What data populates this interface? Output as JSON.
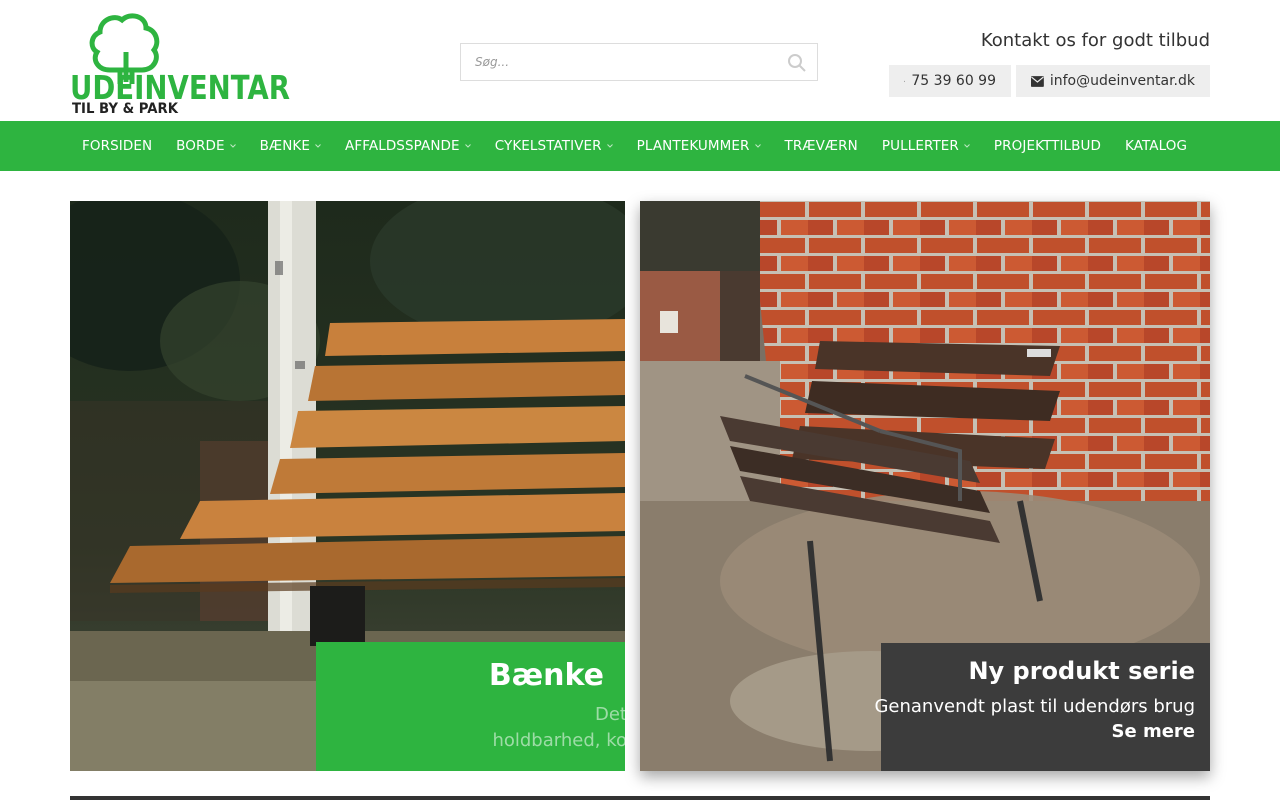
{
  "brand": {
    "logo_main": "UDEINVENTAR",
    "logo_tagline": "TIL BY & PARK",
    "color": "#2eb440"
  },
  "search": {
    "placeholder": "Søg..."
  },
  "contact": {
    "heading": "Kontakt os for godt tilbud",
    "phone": "75 39 60 99",
    "email": "info@udeinventar.dk"
  },
  "nav": {
    "items": [
      {
        "label": "FORSIDEN",
        "dropdown": false
      },
      {
        "label": "BORDE",
        "dropdown": true
      },
      {
        "label": "BÆNKE",
        "dropdown": true
      },
      {
        "label": "AFFALDSSPANDE",
        "dropdown": true
      },
      {
        "label": "CYKELSTATIVER",
        "dropdown": true
      },
      {
        "label": "PLANTEKUMMER",
        "dropdown": true
      },
      {
        "label": "TRÆVÆRN",
        "dropdown": false
      },
      {
        "label": "PULLERTER",
        "dropdown": true
      },
      {
        "label": "PROJEKTTILBUD",
        "dropdown": false
      },
      {
        "label": "KATALOG",
        "dropdown": false
      }
    ]
  },
  "hero_left": {
    "title": "Bænke",
    "text_line1": "Det",
    "text_line2": "holdbarhed, ko"
  },
  "hero_right": {
    "title": "Ny produkt serie",
    "subtitle": "Genanvendt plast til udendørs brug",
    "link": "Se mere"
  }
}
